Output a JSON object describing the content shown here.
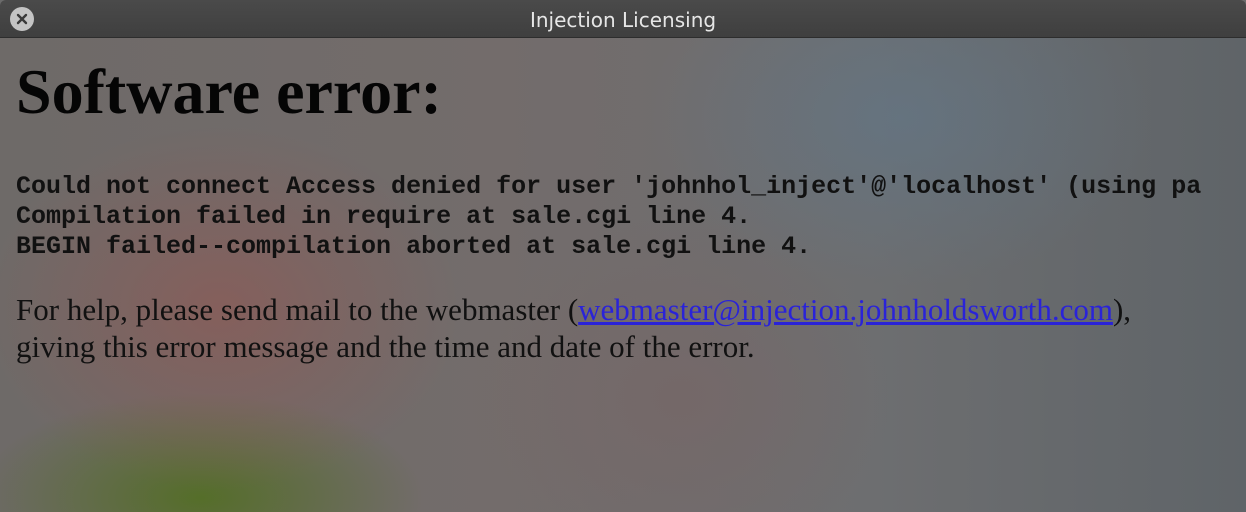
{
  "window": {
    "title": "Injection Licensing"
  },
  "error": {
    "heading": "Software error:",
    "lines": [
      "Could not connect Access denied for user 'johnhol_inject'@'localhost' (using pa",
      "Compilation failed in require at sale.cgi line 4.",
      "BEGIN failed--compilation aborted at sale.cgi line 4."
    ],
    "help_prefix": "For help, please send mail to the webmaster (",
    "help_link": "webmaster@injection.johnholdsworth.com",
    "help_suffix_line1": "),",
    "help_line2": "giving this error message and the time and date of the error."
  },
  "icons": {
    "close": "close-icon"
  }
}
